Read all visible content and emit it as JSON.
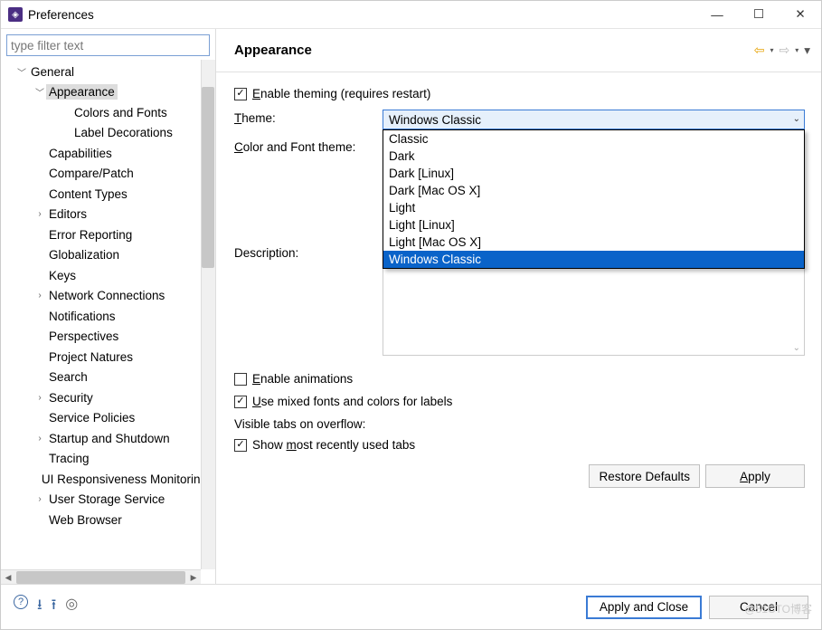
{
  "window": {
    "title": "Preferences"
  },
  "filter": {
    "placeholder": "type filter text"
  },
  "tree": {
    "general": "General",
    "appearance": "Appearance",
    "colors_fonts": "Colors and Fonts",
    "label_decorations": "Label Decorations",
    "capabilities": "Capabilities",
    "compare_patch": "Compare/Patch",
    "content_types": "Content Types",
    "editors": "Editors",
    "error_reporting": "Error Reporting",
    "globalization": "Globalization",
    "keys": "Keys",
    "network_connections": "Network Connections",
    "notifications": "Notifications",
    "perspectives": "Perspectives",
    "project_natures": "Project Natures",
    "search": "Search",
    "security": "Security",
    "service_policies": "Service Policies",
    "startup_shutdown": "Startup and Shutdown",
    "tracing": "Tracing",
    "ui_responsiveness": "UI Responsiveness Monitoring",
    "user_storage": "User Storage Service",
    "web_browser": "Web Browser"
  },
  "page": {
    "title": "Appearance",
    "enable_theming": "nable theming (requires restart)",
    "enable_theming_mn": "E",
    "theme_label": "heme:",
    "theme_label_mn": "T",
    "theme_value": "Windows Classic",
    "color_font_label": "olor and Font theme:",
    "color_font_label_mn": "C",
    "theme_options": [
      "Classic",
      "Dark",
      "Dark [Linux]",
      "Dark [Mac OS X]",
      "Light",
      "Light [Linux]",
      "Light [Mac OS X]",
      "Windows Classic"
    ],
    "description_label": "Description:",
    "enable_animations": "nable animations",
    "enable_animations_mn": "E",
    "use_mixed": "se mixed fonts and colors for labels",
    "use_mixed_mn": "U",
    "visible_tabs_label": "Visible tabs on overflow:",
    "show_most_recent_pre": "Show ",
    "show_most_recent_mn": "m",
    "show_most_recent_post": "ost recently used tabs",
    "restore_defaults": "Restore Defaults",
    "apply": "Apply",
    "apply_mn": "A"
  },
  "footer": {
    "apply_close": "Apply and Close",
    "cancel": "Cancel"
  },
  "watermark": "@51CTO博客"
}
